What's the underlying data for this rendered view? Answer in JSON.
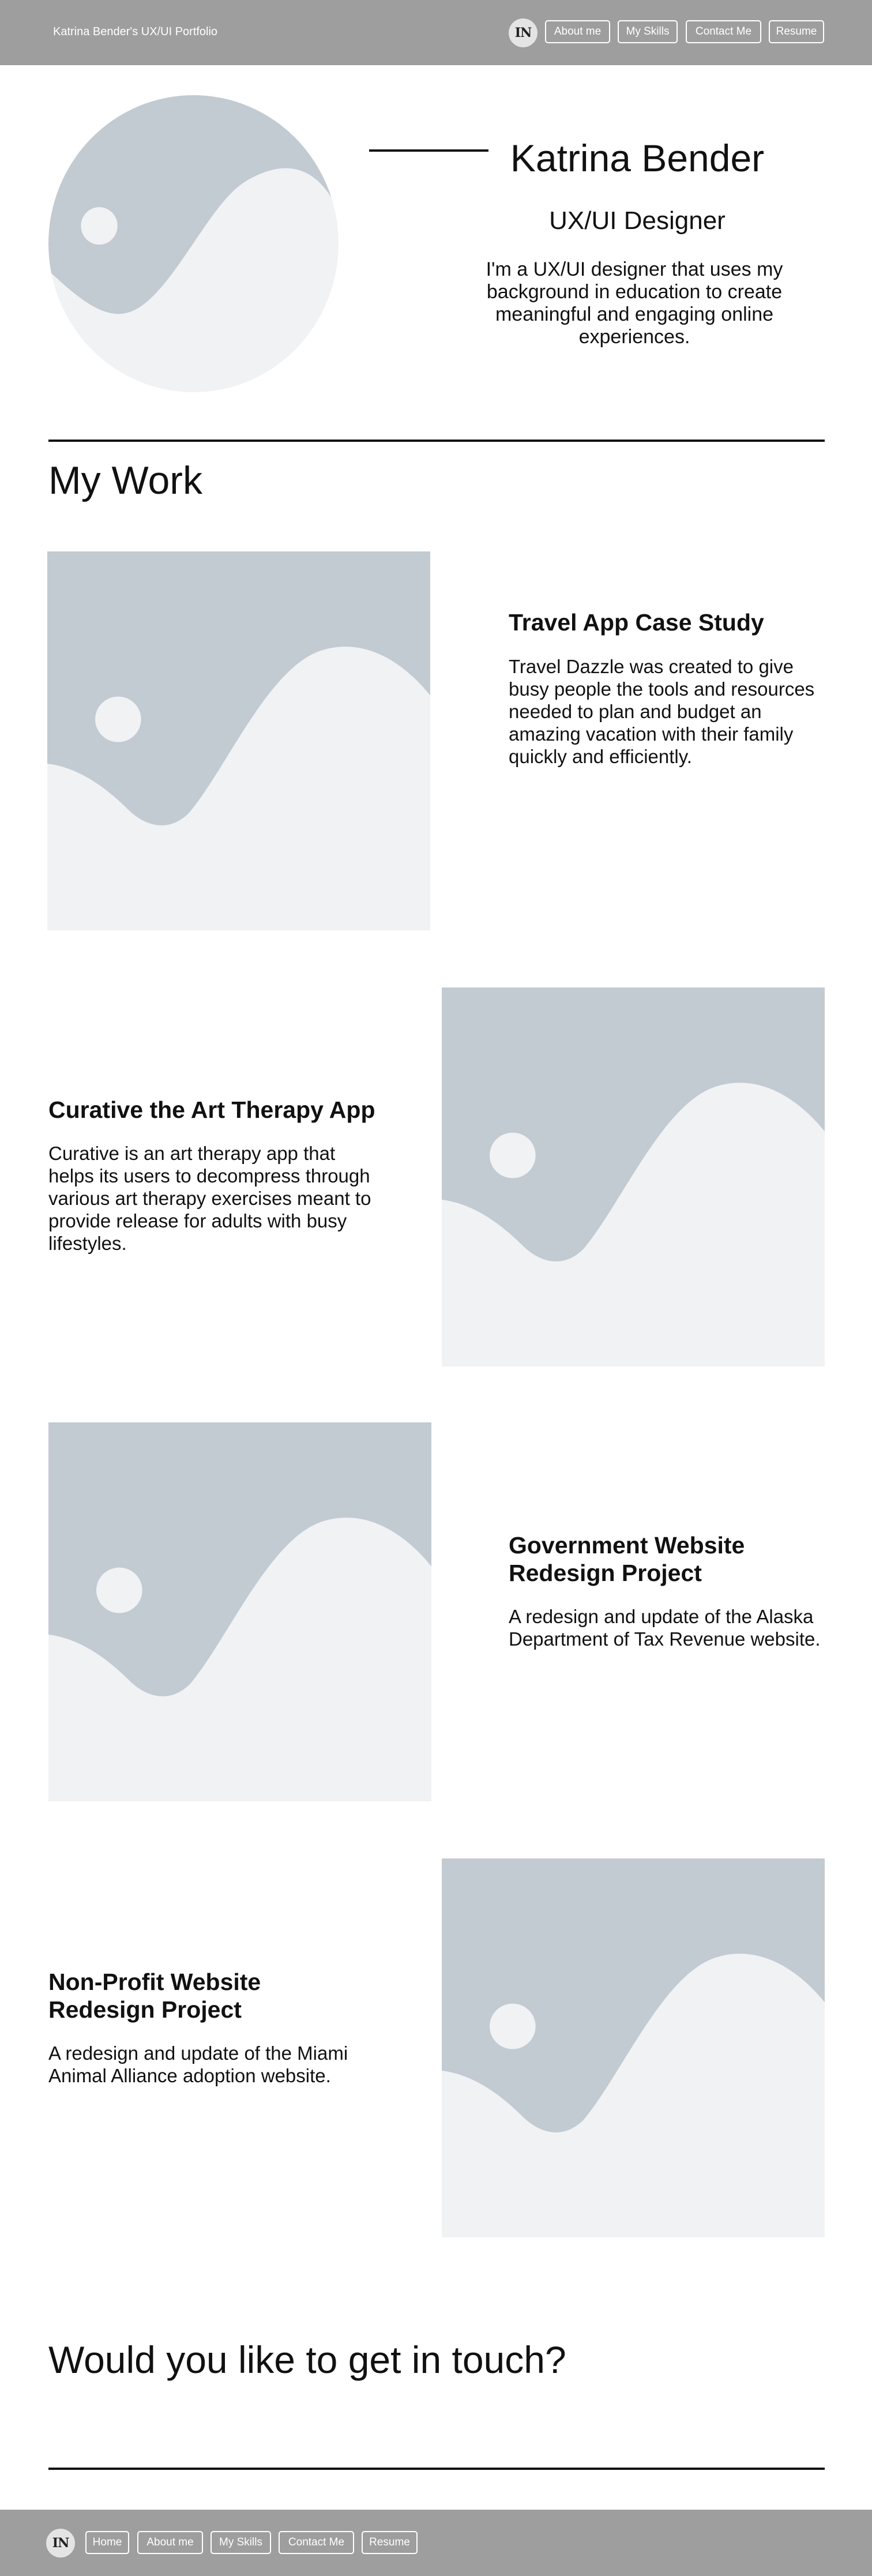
{
  "header": {
    "site_title": "Katrina Bender's UX/UI Portfolio",
    "logo_text": "IN",
    "nav": [
      "About me",
      "My Skills",
      "Contact Me",
      "Resume"
    ]
  },
  "hero": {
    "name": "Katrina Bender",
    "role": "UX/UI Designer",
    "bio": "I'm a UX/UI designer that uses my background in education to create meaningful and engaging online experiences."
  },
  "work": {
    "title": "My Work",
    "projects": [
      {
        "title": "Travel App Case Study",
        "description": "Travel Dazzle was created to give busy people the tools and resources needed to plan and budget an amazing vacation with their family quickly and efficiently."
      },
      {
        "title": "Curative the Art Therapy App",
        "description": "Curative is an art therapy app that helps its users to decompress through various art therapy exercises meant to provide release for adults with busy lifestyles."
      },
      {
        "title": "Government Website Redesign Project",
        "description": "A redesign and update of the Alaska Department of Tax Revenue website."
      },
      {
        "title": "Non-Profit Website Redesign Project",
        "description": "A redesign and update of the Miami Animal Alliance adoption website."
      }
    ]
  },
  "contact": {
    "prompt": "Would you like to get in touch?"
  },
  "footer": {
    "logo_text": "IN",
    "nav": [
      "Home",
      "About me",
      "My Skills",
      "Contact Me",
      "Resume"
    ]
  },
  "colors": {
    "bar_background": "#9e9e9e",
    "placeholder_dark": "#c2cad2",
    "placeholder_light": "#f1f2f4"
  },
  "icons": [
    "logo-monogram-icon",
    "image-placeholder-icon"
  ]
}
